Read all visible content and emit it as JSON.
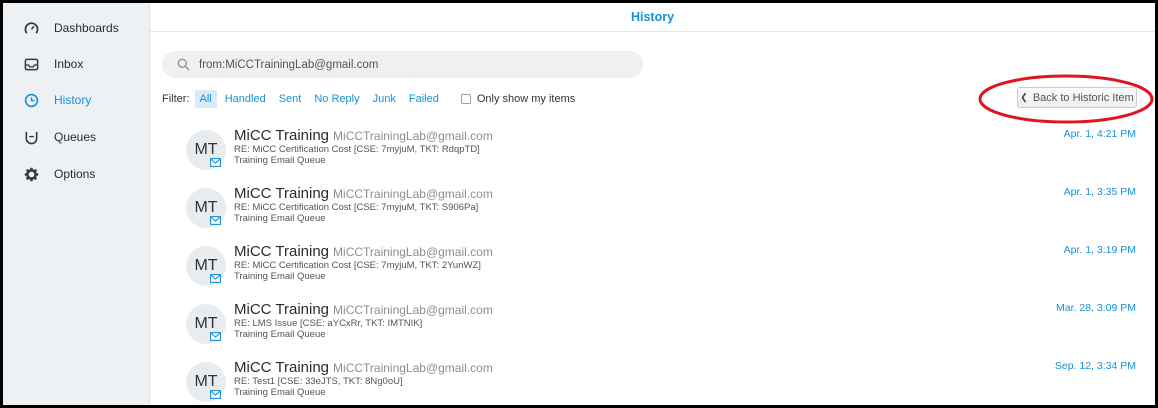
{
  "sidebar": {
    "items": [
      {
        "label": "Dashboards",
        "icon": "dashboard-gauge-icon",
        "active": false
      },
      {
        "label": "Inbox",
        "icon": "inbox-tray-icon",
        "active": false
      },
      {
        "label": "History",
        "icon": "history-clock-icon",
        "active": true
      },
      {
        "label": "Queues",
        "icon": "queues-icon",
        "active": false
      },
      {
        "label": "Options",
        "icon": "gear-icon",
        "active": false
      }
    ]
  },
  "header": {
    "title": "History"
  },
  "search": {
    "value": "from:MiCCTrainingLab@gmail.com"
  },
  "filters": {
    "label": "Filter:",
    "options": [
      "All",
      "Handled",
      "Sent",
      "No Reply",
      "Junk",
      "Failed"
    ],
    "selected": "All",
    "only_mine_label": "Only show my items",
    "only_mine_checked": false
  },
  "back_button": {
    "label": "Back to Historic Item"
  },
  "history": [
    {
      "initials": "MT",
      "name": "MiCC Training",
      "email": "MiCCTrainingLab@gmail.com",
      "subject": "RE: MiCC Certification Cost [CSE: 7myjuM, TKT: RdqpTD]",
      "queue": "Training Email Queue",
      "time": "Apr. 1, 4:21 PM"
    },
    {
      "initials": "MT",
      "name": "MiCC Training",
      "email": "MiCCTrainingLab@gmail.com",
      "subject": "RE: MiCC Certification Cost [CSE: 7myjuM, TKT: S906Pa]",
      "queue": "Training Email Queue",
      "time": "Apr. 1, 3:35 PM"
    },
    {
      "initials": "MT",
      "name": "MiCC Training",
      "email": "MiCCTrainingLab@gmail.com",
      "subject": "RE: MiCC Certification Cost [CSE: 7myjuM, TKT: 2YunWZ]",
      "queue": "Training Email Queue",
      "time": "Apr. 1, 3:19 PM"
    },
    {
      "initials": "MT",
      "name": "MiCC Training",
      "email": "MiCCTrainingLab@gmail.com",
      "subject": "RE: LMS Issue [CSE: aYCxRr, TKT: IMTNIK]",
      "queue": "Training Email Queue",
      "time": "Mar. 28, 3:09 PM"
    },
    {
      "initials": "MT",
      "name": "MiCC Training",
      "email": "MiCCTrainingLab@gmail.com",
      "subject": "RE: Test1 [CSE: 33eJTS, TKT: 8Ng0oU]",
      "queue": "Training Email Queue",
      "time": "Sep. 12, 3:34 PM"
    }
  ],
  "colors": {
    "accent": "#1a8fd8",
    "sidebar_bg": "#eef1f4",
    "annotation": "#e0141e"
  }
}
